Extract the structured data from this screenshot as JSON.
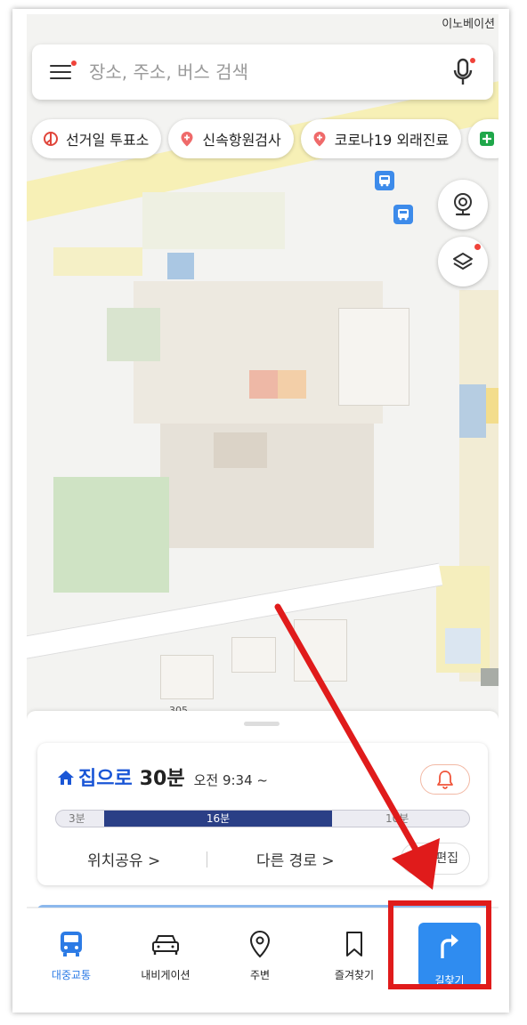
{
  "status": {
    "corner_text": "이노베이션"
  },
  "search": {
    "placeholder": "장소, 주소, 버스 검색"
  },
  "chips": [
    {
      "label": "선거일 투표소",
      "icon": "ballot-icon",
      "color": "#e0453a"
    },
    {
      "label": "신속항원검사",
      "icon": "pin-plus-icon",
      "color": "#ef6a6a"
    },
    {
      "label": "코로나19 외래진료",
      "icon": "pin-plus-icon",
      "color": "#ef6a6a"
    },
    {
      "label": "",
      "icon": "plus-icon",
      "color": "#1fa74a"
    }
  ],
  "map": {
    "road_label": "305"
  },
  "commute": {
    "home_label": "집으로",
    "duration": "30분",
    "departure": "오전 9:34 ~",
    "segments": {
      "walk_before": "3분",
      "ride": "16분",
      "walk_after": "10분"
    },
    "share_label": "위치공유 >",
    "other_routes_label": "다른 경로 >",
    "edit_label": "주소편집"
  },
  "nav": {
    "items": [
      {
        "label": "대중교통",
        "icon": "bus-icon",
        "active": true
      },
      {
        "label": "내비게이션",
        "icon": "car-icon",
        "active": false
      },
      {
        "label": "주변",
        "icon": "pin-icon",
        "active": false
      },
      {
        "label": "즐겨찾기",
        "icon": "bookmark-icon",
        "active": false
      }
    ],
    "route_button_label": "길찾기"
  },
  "colors": {
    "accent": "#2f8cf0",
    "active_tab": "#2c7be5",
    "annotation_red": "#e01b1b",
    "ride_bar": "#2a3f86"
  }
}
